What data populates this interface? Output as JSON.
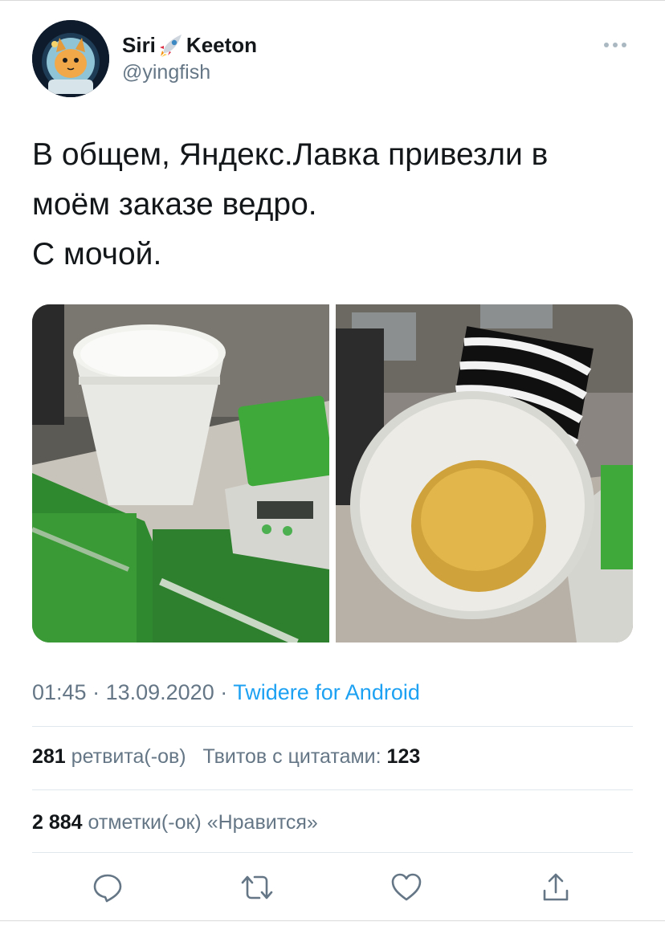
{
  "author": {
    "name_part1": "Siri",
    "name_part2": "Keeton",
    "name_emoji": "rocket-icon",
    "handle": "@yingfish"
  },
  "tweet": {
    "lines": [
      "В общем, Яндекс.Лавка привезли в",
      "моём заказе ведро.",
      "С мочой."
    ]
  },
  "meta": {
    "time": "01:45",
    "sep1": " · ",
    "date": "13.09.2020",
    "sep2": " · ",
    "client": "Twidere for Android"
  },
  "stats": {
    "retweets_count": "281",
    "retweets_label": "ретвита(-ов)",
    "quotes_label": "Твитов с цитатами:",
    "quotes_count": "123",
    "likes_count": "2 884",
    "likes_label": "отметки(-ок) «Нравится»"
  },
  "actions": [
    "reply-icon",
    "retweet-icon",
    "like-icon",
    "share-icon"
  ],
  "colors": {
    "accent": "#1da1f2",
    "secondary_text": "#657786",
    "icon": "#657786"
  }
}
